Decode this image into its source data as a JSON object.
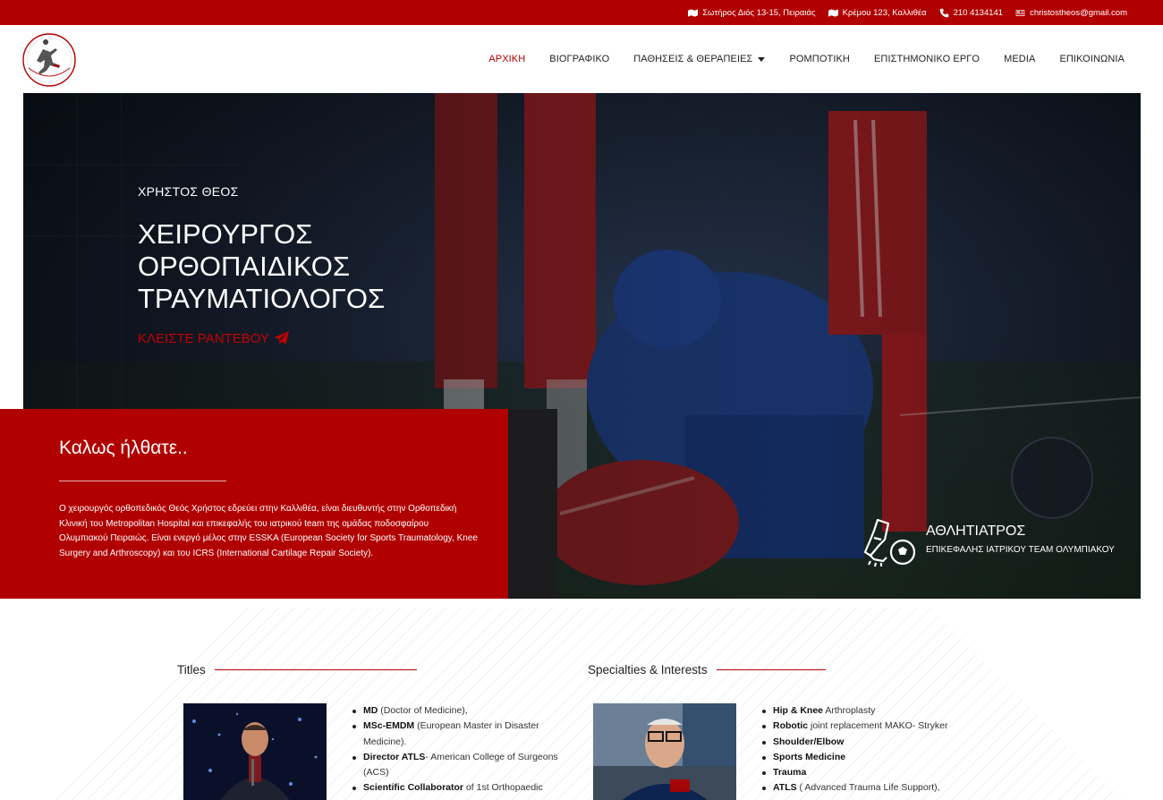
{
  "topbar": {
    "address1": "Σωτήρος Διός 13-15, Πειραιάς",
    "address2": "Κρέμου 123, Καλλιθέα",
    "phone": "210 4134141",
    "email": "christostheos@gmail.com"
  },
  "nav": {
    "items": [
      {
        "label": "ΑΡΧΙΚΗ"
      },
      {
        "label": "ΒΙΟΓΡΑΦΙΚΟ"
      },
      {
        "label": "ΠΑΘΗΣΕΙΣ & ΘΕΡΑΠΕΙΕΣ"
      },
      {
        "label": "ΡΟΜΠΟΤΙΚΗ"
      },
      {
        "label": "ΕΠΙΣΤΗΜΟΝΙΚΟ ΕΡΓΟ"
      },
      {
        "label": "MEDIA"
      },
      {
        "label": "ΕΠΙΚΟΙΝΩΝΙΑ"
      }
    ]
  },
  "hero": {
    "name": "ΧΡΗΣΤΟΣ ΘΕΟΣ",
    "title_line1": "ΧΕΙΡΟΥΡΓΟΣ",
    "title_line2": "ΟΡΘΟΠΑΙΔΙΚΟΣ",
    "title_line3": "ΤΡΑΥΜΑΤΙΟΛΟΓΟΣ",
    "cta": "ΚΛΕΙΣΤΕ ΡΑΝΤΕΒΟΥ"
  },
  "welcome": {
    "heading": "Καλως ήλθατε..",
    "text": "Ο χειρουργός ορθοπεδικός Θεός Χρήστος εδρεύει στην Καλλιθέα, είναι διευθυντής στην Ορθοπεδική Κλινική του Metropolitan Hospital και επικεφαλής του ιατρικού team της ομάδας ποδοσφαίρου Ολυμπιακού Πειραιώς. Είναι ενεργό μέλος στην ESSKA (European Society for Sports Traumatology, Knee Surgery and Arthroscopy) και του ICRS (International Cartilage Repair Society)."
  },
  "badge": {
    "title": "ΑΘΛΗΤΙΑΤΡΟΣ",
    "subtitle": "ΕΠΙΚΕΦΑΛΗΣ ΙΑΤΡΙΚΟΥ TEAM ΟΛΥΜΠΙΑΚΟΥ"
  },
  "titles": {
    "heading": "Titles",
    "items": [
      {
        "bold": "MD",
        "rest": " (Doctor of Medicine),"
      },
      {
        "bold": "MSc-EMDM",
        "rest": " (European Master in Disaster Medicine)."
      },
      {
        "bold": "Director ATLS",
        "rest": "- American College of Surgeons (ACS)"
      },
      {
        "bold": "Scientific Collaborator",
        "rest": " of 1st Orthopaedic"
      }
    ]
  },
  "specialties": {
    "heading": "Specialties & Interests",
    "items": [
      {
        "bold": "Hip & Knee",
        "rest": " Arthroplasty"
      },
      {
        "bold": "Robotic",
        "rest": " joint replacement MAKO- Stryker"
      },
      {
        "bold": "Shoulder/Elbow",
        "rest": ""
      },
      {
        "bold": "Sports Medicine",
        "rest": ""
      },
      {
        "bold": "Trauma",
        "rest": ""
      },
      {
        "bold": "ATLS",
        "rest": " ( Advanced Trauma Life Support),"
      }
    ]
  },
  "colors": {
    "brand_red": "#b10000",
    "cta_red": "#c40000",
    "hero_dark": "#141a22"
  }
}
